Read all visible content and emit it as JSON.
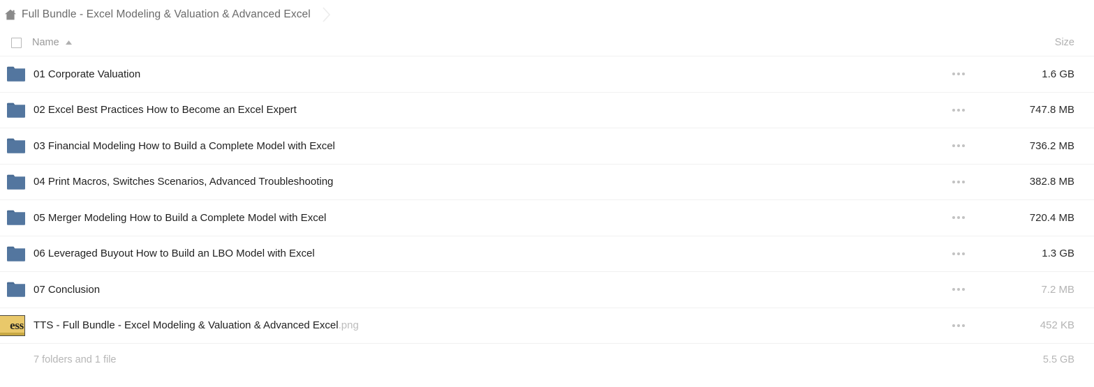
{
  "breadcrumb": {
    "home_icon": "home-icon",
    "path_label": "Full Bundle - Excel Modeling & Valuation & Advanced Excel",
    "separator_icon": "chevron-right-icon"
  },
  "columns": {
    "select_all_icon": "checkbox-unchecked-icon",
    "name_label": "Name",
    "sort_icon": "sort-ascending-icon",
    "size_label": "Size"
  },
  "row_menu_icon": "ellipsis-icon",
  "colors": {
    "folder": "#53769f",
    "folder_tab": "#4a6c94",
    "thumbnail": "#e9c86a",
    "text": "#1f1f1f",
    "muted_text": "#b4b4b4",
    "divider": "#f1f1f1"
  },
  "rows": [
    {
      "icon": "folder-icon",
      "name": "01 Corporate Valuation",
      "ext": "",
      "size": "1.6 GB",
      "size_muted": false,
      "type": "folder"
    },
    {
      "icon": "folder-icon",
      "name": "02 Excel Best Practices How to Become an Excel Expert",
      "ext": "",
      "size": "747.8 MB",
      "size_muted": false,
      "type": "folder"
    },
    {
      "icon": "folder-icon",
      "name": "03 Financial Modeling How to Build a Complete Model with Excel",
      "ext": "",
      "size": "736.2 MB",
      "size_muted": false,
      "type": "folder"
    },
    {
      "icon": "folder-icon",
      "name": "04 Print Macros, Switches Scenarios, Advanced Troubleshooting",
      "ext": "",
      "size": "382.8 MB",
      "size_muted": false,
      "type": "folder"
    },
    {
      "icon": "folder-icon",
      "name": "05 Merger Modeling How to Build a Complete Model with Excel",
      "ext": "",
      "size": "720.4 MB",
      "size_muted": false,
      "type": "folder"
    },
    {
      "icon": "folder-icon",
      "name": "06 Leveraged Buyout How to Build an LBO Model with Excel",
      "ext": "",
      "size": "1.3 GB",
      "size_muted": false,
      "type": "folder"
    },
    {
      "icon": "folder-icon",
      "name": "07 Conclusion",
      "ext": "",
      "size": "7.2 MB",
      "size_muted": true,
      "type": "folder"
    },
    {
      "icon": "image-thumbnail-icon",
      "name": "TTS - Full Bundle - Excel Modeling & Valuation & Advanced Excel",
      "ext": ".png",
      "size": "452 KB",
      "size_muted": true,
      "type": "image",
      "thumbnail_text": "ess"
    }
  ],
  "footer": {
    "summary": "7 folders and 1 file",
    "total_size": "5.5 GB"
  }
}
